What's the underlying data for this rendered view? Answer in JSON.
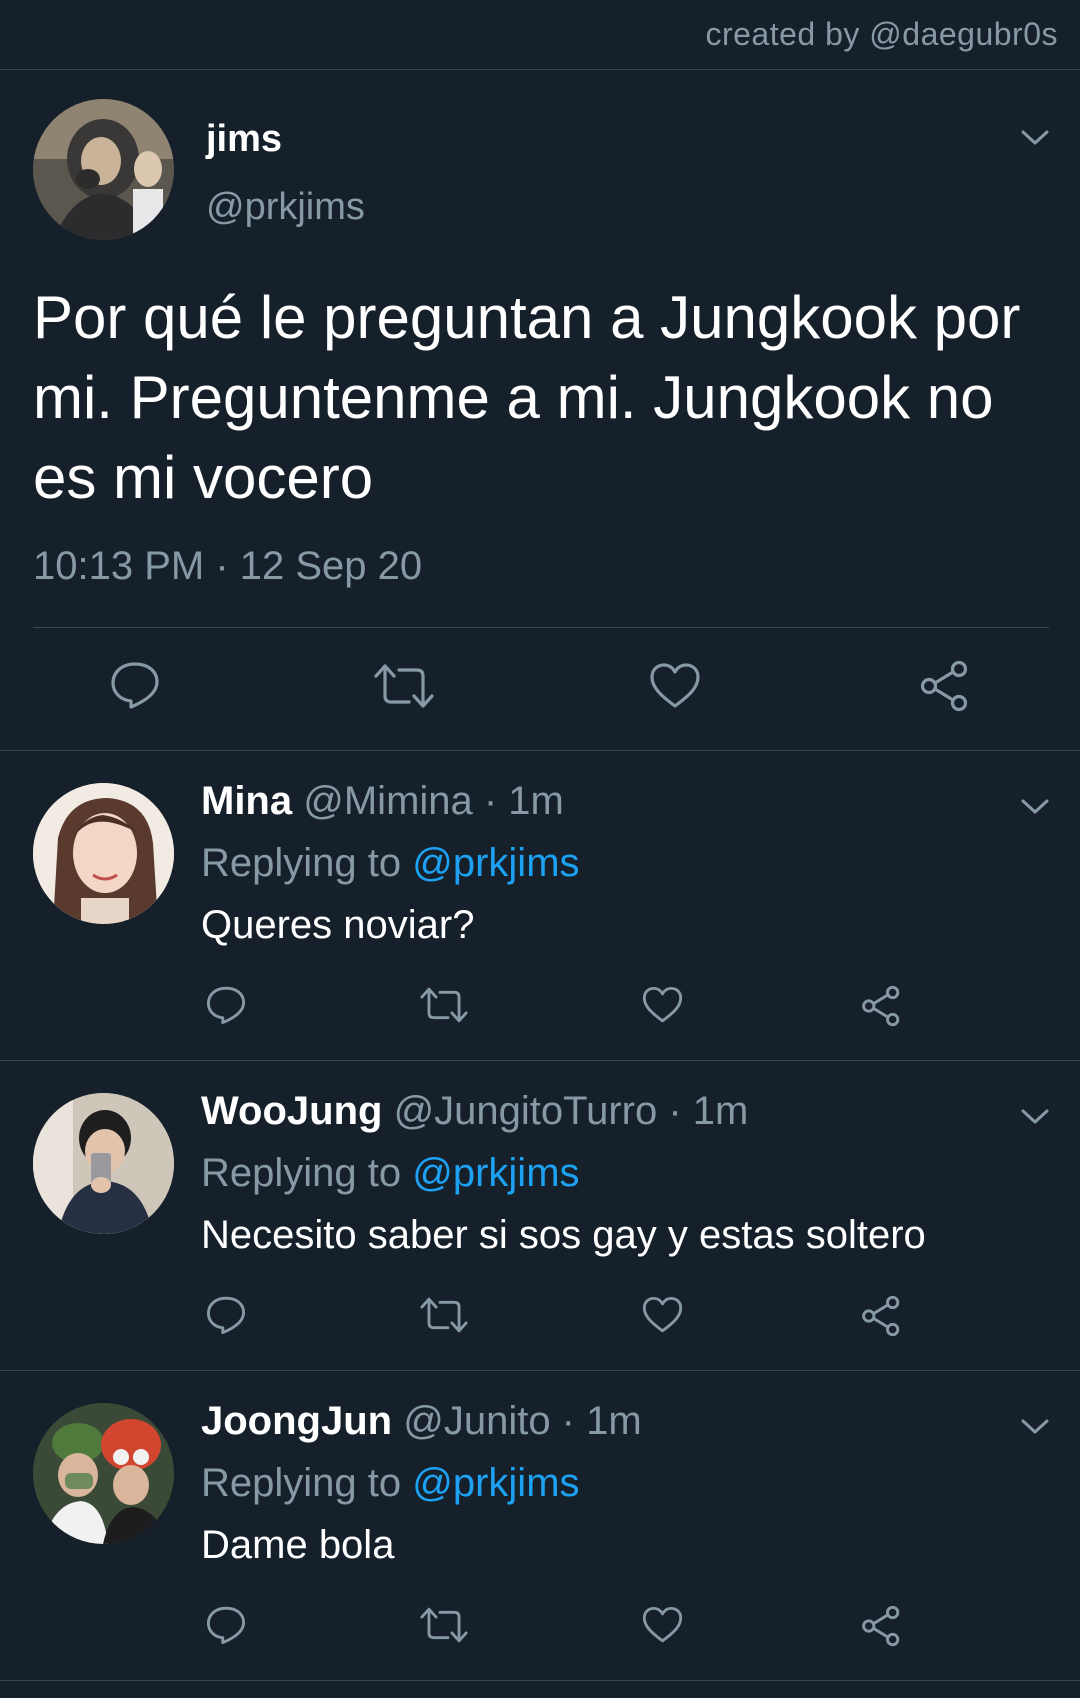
{
  "credit": "created by @daegubr0s",
  "main_tweet": {
    "name": "jims",
    "handle": "@prkjims",
    "text": "Por qué le preguntan a Jungkook por mi. Preguntenme a mi. Jungkook no es mi vocero",
    "time": "10:13 PM · 12 Sep 20",
    "icons": [
      "reply-icon",
      "retweet-icon",
      "like-icon",
      "share-icon",
      "chevron-down-icon"
    ]
  },
  "replies": [
    {
      "name": "Mina",
      "meta": "@Mimina · 1m",
      "replying_label": "Replying to",
      "mention": "@prkjims",
      "text": "Queres noviar?"
    },
    {
      "name": "WooJung",
      "meta": "@JungitoTurro · 1m",
      "replying_label": "Replying to",
      "mention": "@prkjims",
      "text": "Necesito saber si sos gay y estas soltero"
    },
    {
      "name": "JoongJun",
      "meta": "@Junito · 1m",
      "replying_label": "Replying to",
      "mention": "@prkjims",
      "text": "Dame bola"
    }
  ],
  "colors": {
    "background": "#15202b",
    "divider": "#38444d",
    "secondary_text": "#8899a6",
    "link": "#1da1f2",
    "primary_text": "#ffffff"
  }
}
